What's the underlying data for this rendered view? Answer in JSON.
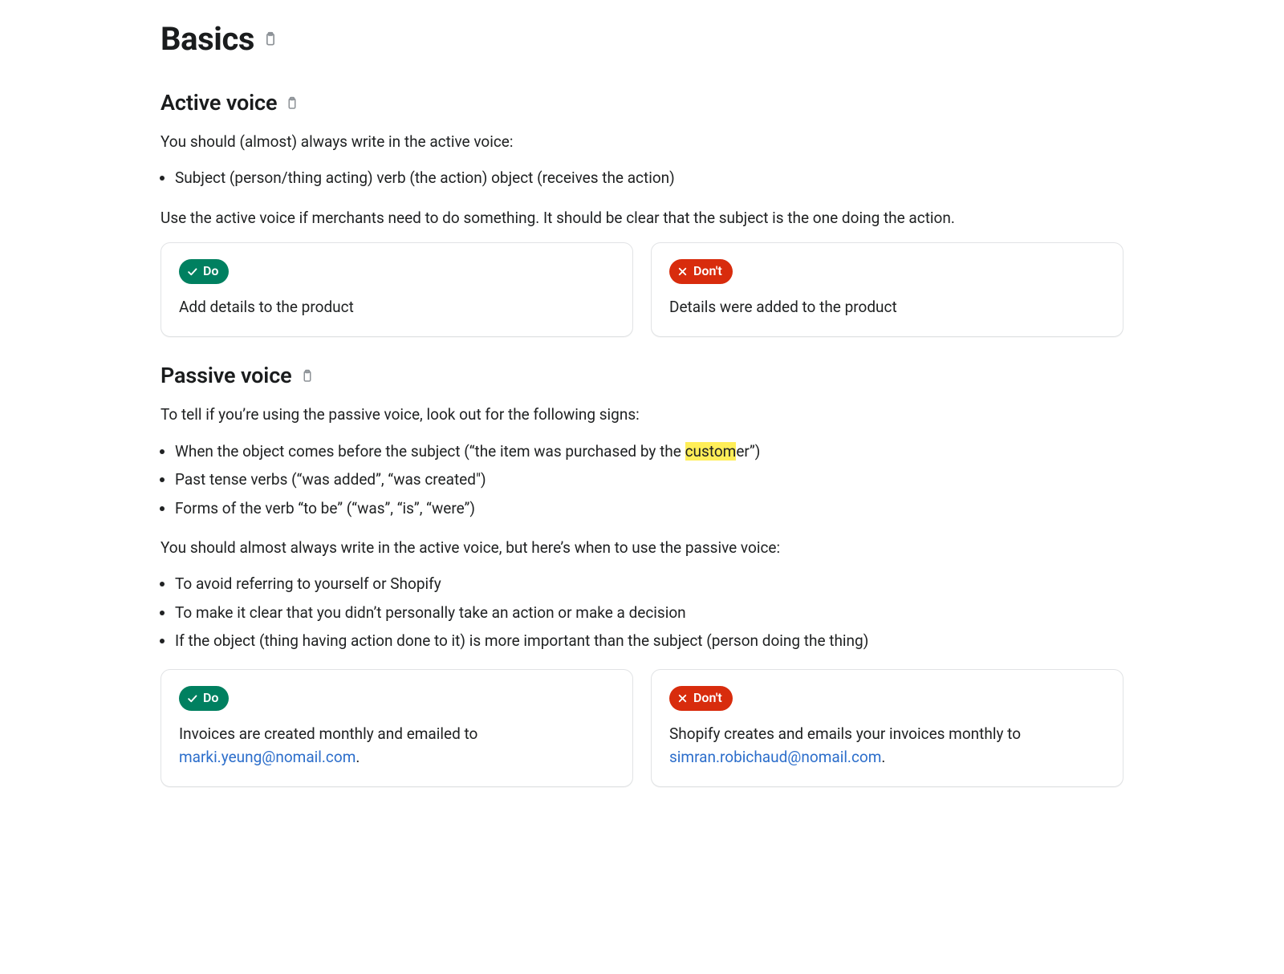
{
  "title": "Basics",
  "sections": {
    "active": {
      "heading": "Active voice",
      "intro": "You should (almost) always write in the active voice:",
      "bullets": [
        "Subject (person/thing acting) verb (the action) object (receives the action)"
      ],
      "para2": "Use the active voice if merchants need to do something. It should be clear that the subject is the one doing the action.",
      "do_label": "Do",
      "do_text": "Add details to the product",
      "dont_label": "Don't",
      "dont_text": "Details were added to the product"
    },
    "passive": {
      "heading": "Passive voice",
      "intro": "To tell if you’re using the passive voice, look out for the following signs:",
      "bullet1_pre": "When the object comes before the subject (“the item was purchased by the ",
      "bullet1_hi": "custom",
      "bullet1_post": "er”)",
      "bullet2": "Past tense verbs (“was added”, “was created\")",
      "bullet3": "Forms of the verb “to be” (“was”, “is”, “were”)",
      "para2": "You should almost always write in the active voice, but here’s when to use the passive voice:",
      "when_bullets": [
        "To avoid referring to yourself or Shopify",
        "To make it clear that you didn’t personally take an action or make a decision",
        "If the object (thing having action done to it) is more important than the subject (person doing the thing)"
      ],
      "do_label": "Do",
      "do_pre": "Invoices are created monthly and emailed to ",
      "do_link": "marki.yeung@nomail.com",
      "do_post": ".",
      "dont_label": "Don't",
      "dont_pre": "Shopify creates and emails your invoices monthly to ",
      "dont_link": "simran.robichaud@nomail.com",
      "dont_post": "."
    }
  }
}
